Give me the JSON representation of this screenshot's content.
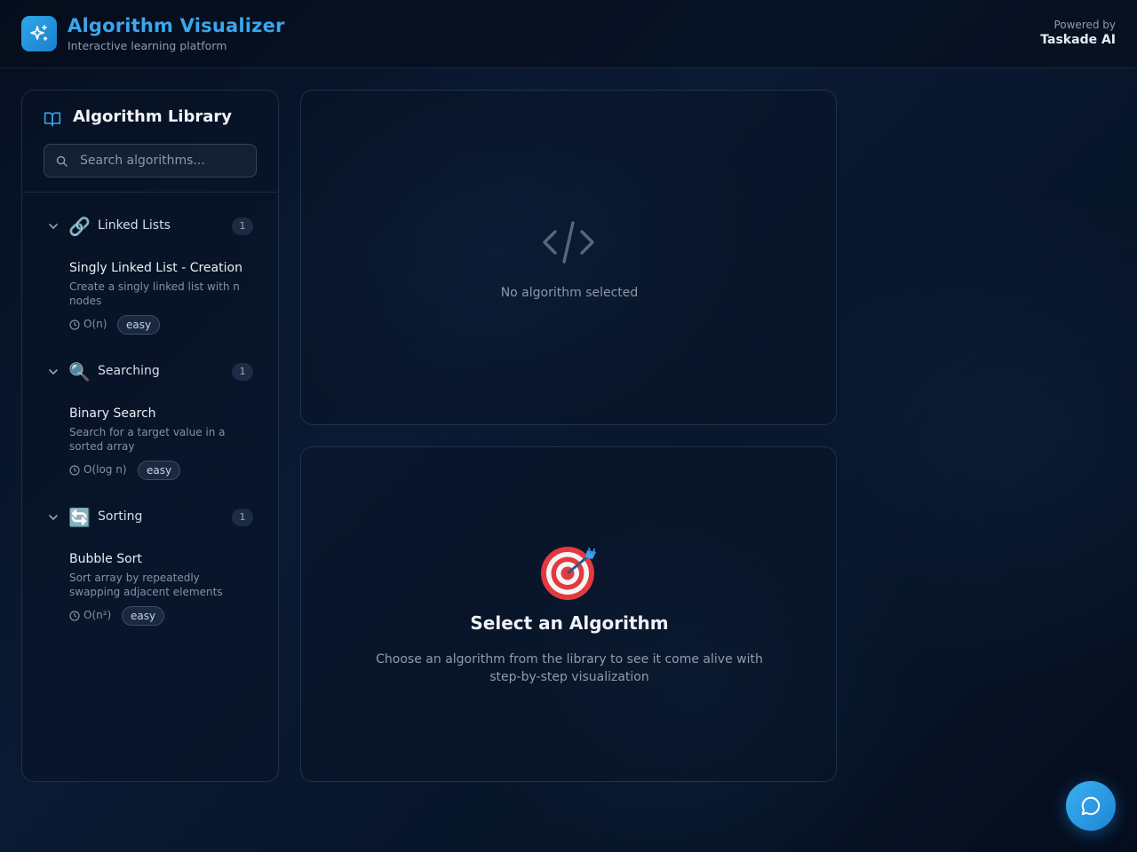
{
  "header": {
    "title": "Algorithm Visualizer",
    "subtitle": "Interactive learning platform",
    "powered_by": "Powered by",
    "brand": "Taskade AI",
    "logo_icon": "sparkles-icon"
  },
  "sidebar": {
    "title": "Algorithm Library",
    "title_icon": "book-open-icon",
    "search": {
      "placeholder": "Search algorithms...",
      "value": ""
    },
    "categories": [
      {
        "label": "Linked Lists",
        "emoji": "🔗",
        "count": "1",
        "items": [
          {
            "name": "Singly Linked List - Creation",
            "description": "Create a singly linked list with n nodes",
            "complexity": "O(n)",
            "difficulty": "easy"
          }
        ]
      },
      {
        "label": "Searching",
        "emoji": "🔍",
        "count": "1",
        "items": [
          {
            "name": "Binary Search",
            "description": "Search for a target value in a sorted array",
            "complexity": "O(log n)",
            "difficulty": "easy"
          }
        ]
      },
      {
        "label": "Sorting",
        "emoji": "🔄",
        "count": "1",
        "items": [
          {
            "name": "Bubble Sort",
            "description": "Sort array by repeatedly swapping adjacent elements",
            "complexity": "O(n²)",
            "difficulty": "easy"
          }
        ]
      }
    ]
  },
  "visualizer": {
    "empty_text": "No algorithm selected",
    "icon": "code-icon"
  },
  "welcome": {
    "emoji": "🎯",
    "title": "Select an Algorithm",
    "description": "Choose an algorithm from the library to see it come alive with step-by-step visualization"
  },
  "chat": {
    "icon": "chat-bubble-icon"
  },
  "colors": {
    "accent": "#3aa6ee",
    "background": "#0a1a33",
    "panel_border": "#2a3d58",
    "muted_text": "#8391a5"
  }
}
